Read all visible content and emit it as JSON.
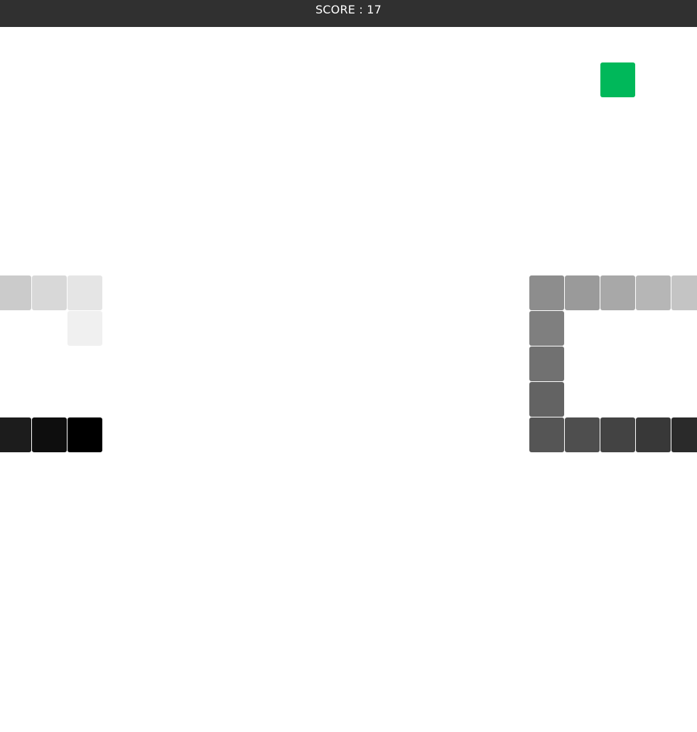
{
  "header": {
    "score_text": "SCORE : 17",
    "background": "#303030",
    "text_color": "#ffffff"
  },
  "board": {
    "background": "#ffffff",
    "grid_cell": 50,
    "origin_col": 5,
    "origin_row": 1,
    "food": {
      "col": 17,
      "row": 1,
      "color": "#00b85a"
    },
    "snake": [
      {
        "col": 2,
        "row": 11,
        "color": "#000000"
      },
      {
        "col": 1,
        "row": 11,
        "color": "#0e0e0e"
      },
      {
        "col": 0,
        "row": 11,
        "color": "#1c1c1c"
      },
      {
        "col": 19,
        "row": 11,
        "color": "#2a2a2a"
      },
      {
        "col": 18,
        "row": 11,
        "color": "#383838"
      },
      {
        "col": 17,
        "row": 11,
        "color": "#434343"
      },
      {
        "col": 16,
        "row": 11,
        "color": "#4e4e4e"
      },
      {
        "col": 15,
        "row": 11,
        "color": "#555555"
      },
      {
        "col": 15,
        "row": 10,
        "color": "#636363"
      },
      {
        "col": 15,
        "row": 9,
        "color": "#717171"
      },
      {
        "col": 15,
        "row": 8,
        "color": "#7f7f7f"
      },
      {
        "col": 15,
        "row": 7,
        "color": "#8d8d8d"
      },
      {
        "col": 16,
        "row": 7,
        "color": "#9a9a9a"
      },
      {
        "col": 17,
        "row": 7,
        "color": "#a8a8a8"
      },
      {
        "col": 18,
        "row": 7,
        "color": "#b6b6b6"
      },
      {
        "col": 19,
        "row": 7,
        "color": "#c4c4c4"
      },
      {
        "col": 0,
        "row": 7,
        "color": "#cbcbcb"
      },
      {
        "col": 1,
        "row": 7,
        "color": "#d8d8d8"
      },
      {
        "col": 2,
        "row": 7,
        "color": "#e5e5e5"
      },
      {
        "col": 2,
        "row": 8,
        "color": "#f0f0f0"
      }
    ]
  }
}
